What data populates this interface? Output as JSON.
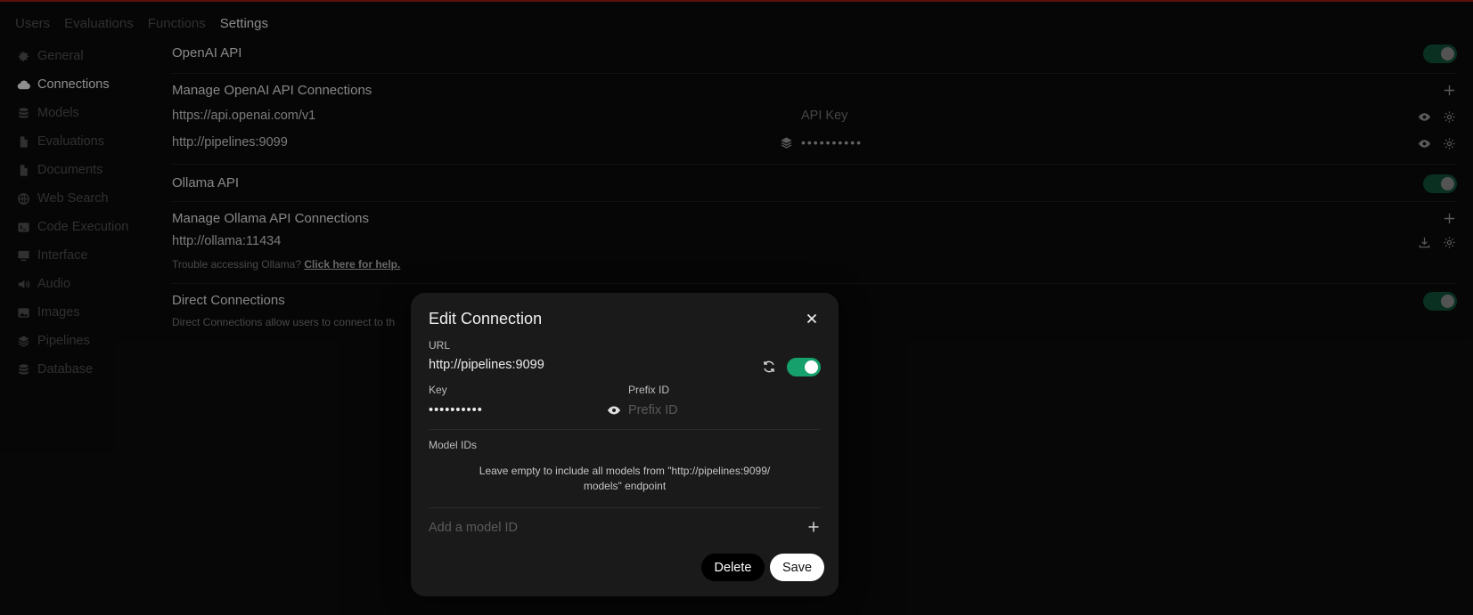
{
  "nav": {
    "tabs": [
      {
        "label": "Users"
      },
      {
        "label": "Evaluations"
      },
      {
        "label": "Functions"
      },
      {
        "label": "Settings"
      }
    ]
  },
  "sidebar": {
    "items": [
      {
        "label": "General",
        "icon": "gear-icon"
      },
      {
        "label": "Connections",
        "icon": "cloud-icon"
      },
      {
        "label": "Models",
        "icon": "database-icon"
      },
      {
        "label": "Evaluations",
        "icon": "document-icon"
      },
      {
        "label": "Documents",
        "icon": "document-icon"
      },
      {
        "label": "Web Search",
        "icon": "globe-icon"
      },
      {
        "label": "Code Execution",
        "icon": "terminal-icon"
      },
      {
        "label": "Interface",
        "icon": "monitor-icon"
      },
      {
        "label": "Audio",
        "icon": "speaker-icon"
      },
      {
        "label": "Images",
        "icon": "image-icon"
      },
      {
        "label": "Pipelines",
        "icon": "layers-icon"
      },
      {
        "label": "Database",
        "icon": "database-icon"
      }
    ]
  },
  "openai": {
    "title": "OpenAI API",
    "manage_title": "Manage OpenAI API Connections",
    "connections": [
      {
        "url": "https://api.openai.com/v1",
        "key_placeholder": "API Key"
      },
      {
        "url": "http://pipelines:9099",
        "key_masked": "••••••••••"
      }
    ]
  },
  "ollama": {
    "title": "Ollama API",
    "manage_title": "Manage Ollama API Connections",
    "url": "http://ollama:11434",
    "help_text": "Trouble accessing Ollama?",
    "help_link": "Click here for help."
  },
  "direct": {
    "title": "Direct Connections",
    "desc": "Direct Connections allow users to connect to th"
  },
  "modal": {
    "title": "Edit Connection",
    "url_label": "URL",
    "url_value": "http://pipelines:9099",
    "key_label": "Key",
    "key_value": "••••••••••",
    "prefix_label": "Prefix ID",
    "prefix_placeholder": "Prefix ID",
    "model_ids_label": "Model IDs",
    "info_line1": "Leave empty to include all models from \"http://pipelines:9099/",
    "info_line2": "models\" endpoint",
    "add_placeholder": "Add a model ID",
    "delete_label": "Delete",
    "save_label": "Save"
  },
  "colors": {
    "accent_toggle": "#16a06b",
    "top_border": "#8b1a14"
  }
}
